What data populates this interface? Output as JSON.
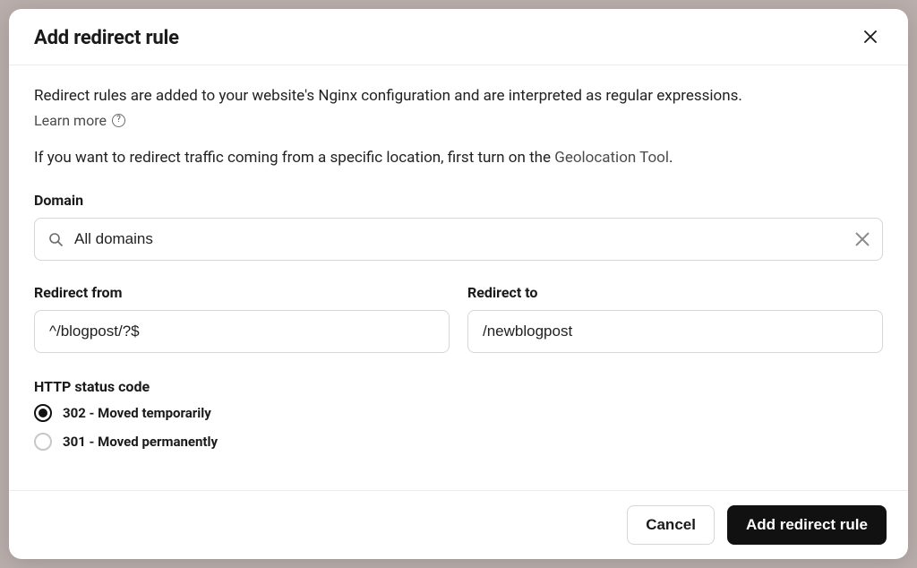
{
  "modal": {
    "title": "Add redirect rule",
    "description": "Redirect rules are added to your website's Nginx configuration and are interpreted as regular expressions.",
    "learn_more": "Learn more",
    "geo_prefix": "If you want to redirect traffic coming from a specific location, first turn on the ",
    "geo_link": "Geolocation Tool",
    "geo_suffix": "."
  },
  "domain": {
    "label": "Domain",
    "value": "All domains"
  },
  "redirect_from": {
    "label": "Redirect from",
    "value": "^/blogpost/?$"
  },
  "redirect_to": {
    "label": "Redirect to",
    "value": "/newblogpost"
  },
  "status": {
    "label": "HTTP status code",
    "options": [
      {
        "label": "302 - Moved temporarily",
        "selected": true
      },
      {
        "label": "301 - Moved permanently",
        "selected": false
      }
    ]
  },
  "footer": {
    "cancel": "Cancel",
    "submit": "Add redirect rule"
  }
}
